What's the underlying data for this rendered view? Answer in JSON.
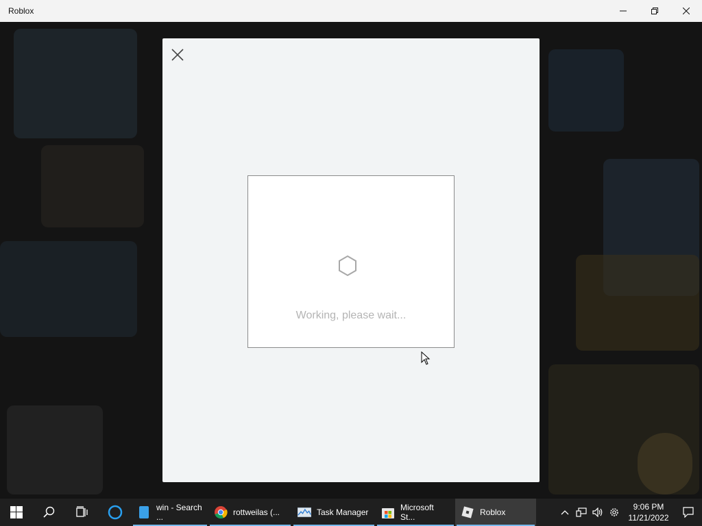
{
  "window": {
    "title": "Roblox",
    "controls": [
      "minimize-icon",
      "restore-icon",
      "close-icon"
    ]
  },
  "dialog": {
    "close_icon": "close-icon",
    "spinner_icon": "hexagon-spinner-icon",
    "message": "Working, please wait..."
  },
  "taskbar": {
    "start_icon": "windows-start-icon",
    "search_icon": "search-icon",
    "taskview_icon": "task-view-icon",
    "cortana_icon": "cortana-icon",
    "apps": [
      {
        "label": "win - Search ...",
        "icon": "notepad-icon",
        "active": false
      },
      {
        "label": "rottweilas (...",
        "icon": "chrome-icon",
        "active": false
      },
      {
        "label": "Task Manager",
        "icon": "task-manager-icon",
        "active": false
      },
      {
        "label": "Microsoft St...",
        "icon": "microsoft-store-icon",
        "active": false
      },
      {
        "label": "Roblox",
        "icon": "roblox-icon",
        "active": true
      }
    ],
    "tray": {
      "icons": [
        "chevron-up-icon",
        "network-icon",
        "volume-icon",
        "settings-icon"
      ],
      "time": "9:06 PM",
      "date": "11/21/2022",
      "notification_icon": "notification-icon"
    }
  },
  "colors": {
    "accent": "#76b9ed",
    "taskbar_bg": "#1f1f1f",
    "modal_bg": "#f2f4f5",
    "message_text": "#b4b4b4"
  }
}
